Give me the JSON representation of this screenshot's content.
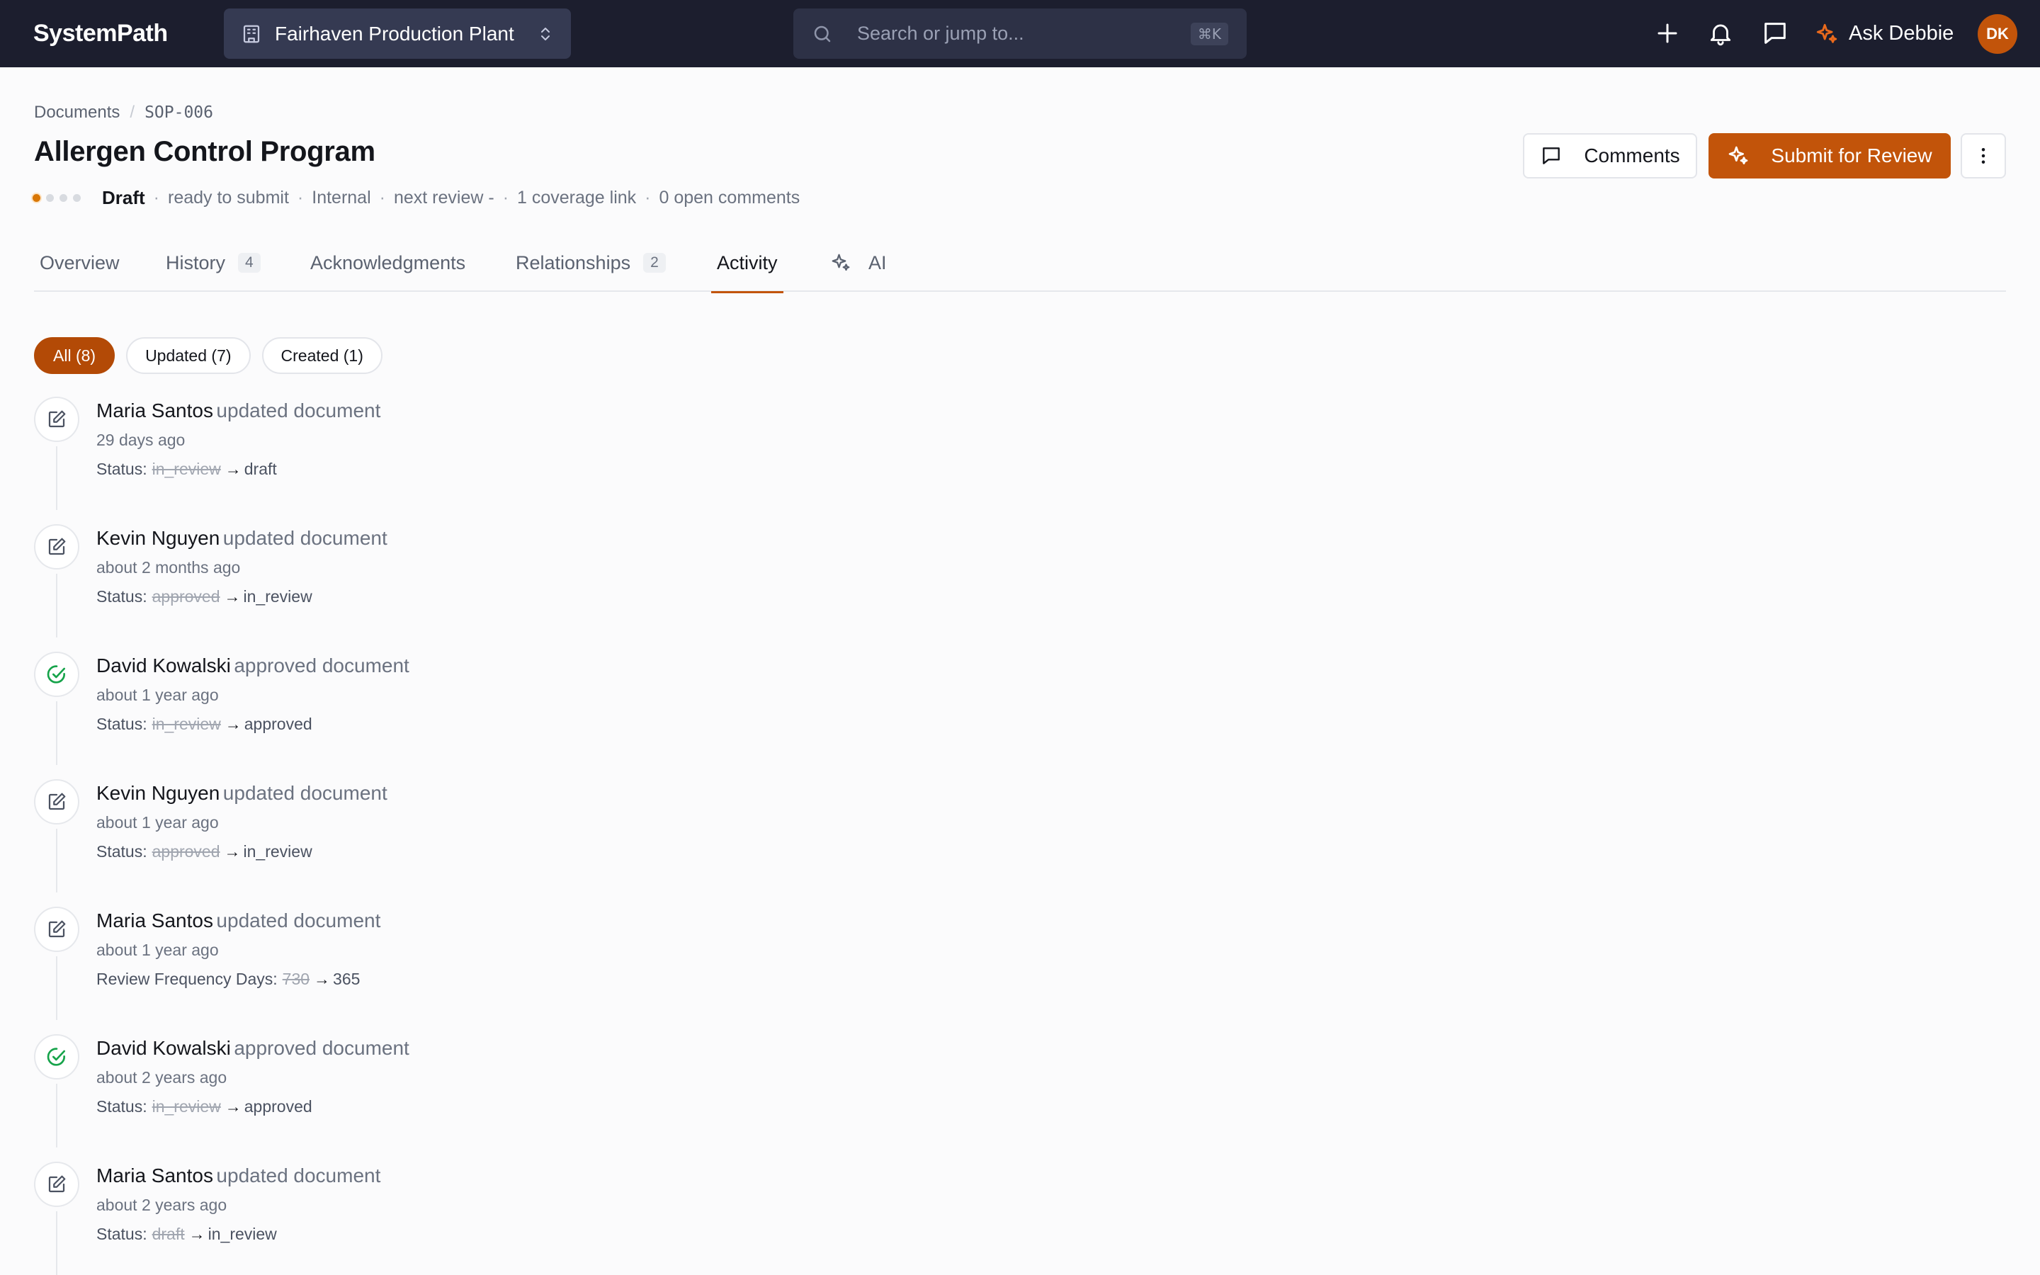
{
  "topbar": {
    "brand": "SystemPath",
    "site": "Fairhaven Production Plant",
    "search_placeholder": "Search or jump to...",
    "search_shortcut": "⌘K",
    "ask_label": "Ask Debbie",
    "avatar_initials": "DK"
  },
  "breadcrumb": {
    "root": "Documents",
    "current": "SOP-006"
  },
  "document": {
    "title": "Allergen Control Program",
    "status": "Draft",
    "meta": [
      "ready to submit",
      "Internal",
      "next review -",
      "1 coverage link",
      "0 open comments"
    ]
  },
  "actions": {
    "comments": "Comments",
    "submit": "Submit for Review"
  },
  "tabs": [
    {
      "label": "Overview",
      "count": ""
    },
    {
      "label": "History",
      "count": "4"
    },
    {
      "label": "Acknowledgments",
      "count": ""
    },
    {
      "label": "Relationships",
      "count": "2"
    },
    {
      "label": "Activity",
      "count": ""
    },
    {
      "label": "AI",
      "count": ""
    }
  ],
  "filters": [
    "All (8)",
    "Updated (7)",
    "Created (1)"
  ],
  "activity": [
    {
      "user": "Maria Santos",
      "action": "updated document",
      "time": "29 days ago",
      "field": "Status:",
      "from": "in_review",
      "to": "draft",
      "icon": "edit-icon"
    },
    {
      "user": "Kevin Nguyen",
      "action": "updated document",
      "time": "about 2 months ago",
      "field": "Status:",
      "from": "approved",
      "to": "in_review",
      "icon": "edit-icon"
    },
    {
      "user": "David Kowalski",
      "action": "approved document",
      "time": "about 1 year ago",
      "field": "Status:",
      "from": "in_review",
      "to": "approved",
      "icon": "check-circle-icon"
    },
    {
      "user": "Kevin Nguyen",
      "action": "updated document",
      "time": "about 1 year ago",
      "field": "Status:",
      "from": "approved",
      "to": "in_review",
      "icon": "edit-icon"
    },
    {
      "user": "Maria Santos",
      "action": "updated document",
      "time": "about 1 year ago",
      "field": "Review Frequency Days:",
      "from": "730",
      "to": "365",
      "icon": "edit-icon"
    },
    {
      "user": "David Kowalski",
      "action": "approved document",
      "time": "about 2 years ago",
      "field": "Status:",
      "from": "in_review",
      "to": "approved",
      "icon": "check-circle-icon"
    },
    {
      "user": "Maria Santos",
      "action": "updated document",
      "time": "about 2 years ago",
      "field": "Status:",
      "from": "draft",
      "to": "in_review",
      "icon": "edit-icon"
    }
  ],
  "colors": {
    "accent": "#c2540a",
    "topbar": "#1c1e2e",
    "success": "#16a34a"
  }
}
